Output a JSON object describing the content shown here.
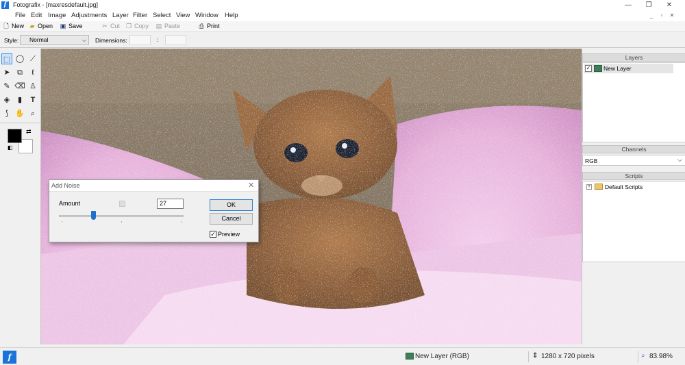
{
  "window": {
    "title": "Fotografix - [maxresdefault.jpg]",
    "app_glyph": "f",
    "controls": {
      "minimize": "—",
      "maximize": "❐",
      "close": "✕"
    },
    "doc_controls": {
      "minimize": "_",
      "restore": "▫",
      "close": "✕"
    }
  },
  "menu": [
    "File",
    "Edit",
    "Image",
    "Adjustments",
    "Layer",
    "Filter",
    "Select",
    "View",
    "Window",
    "Help"
  ],
  "toolbar": {
    "new": "New",
    "open": "Open",
    "save": "Save",
    "cut": "Cut",
    "copy": "Copy",
    "paste": "Paste",
    "print": "Print"
  },
  "options": {
    "style_label": "Style:",
    "style_value": "Normal",
    "dimensions_label": "Dimensions:",
    "dimensions_sep": ":"
  },
  "tools": [
    {
      "name": "rect-select-icon",
      "glyph": "⬚"
    },
    {
      "name": "ellipse-select-icon",
      "glyph": "◯"
    },
    {
      "name": "magic-wand-icon",
      "glyph": "⟋"
    },
    {
      "name": "move-icon",
      "glyph": "➤"
    },
    {
      "name": "crop-icon",
      "glyph": "⧉"
    },
    {
      "name": "lasso-icon",
      "glyph": "ℓ"
    },
    {
      "name": "brush-icon",
      "glyph": "✎"
    },
    {
      "name": "eraser-icon",
      "glyph": "⌫"
    },
    {
      "name": "clone-stamp-icon",
      "glyph": "♙"
    },
    {
      "name": "bucket-icon",
      "glyph": "◈"
    },
    {
      "name": "gradient-icon",
      "glyph": "▮"
    },
    {
      "name": "text-icon",
      "glyph": "T"
    },
    {
      "name": "eyedropper-icon",
      "glyph": "⟆"
    },
    {
      "name": "hand-icon",
      "glyph": "✋"
    },
    {
      "name": "zoom-icon",
      "glyph": "⌕"
    }
  ],
  "colors": {
    "foreground": "#000000",
    "background": "#ffffff",
    "accent": "#2d7fd6"
  },
  "panels": {
    "layers": {
      "title": "Layers",
      "layer_name": "New Layer",
      "visible": true
    },
    "channels": {
      "title": "Channels",
      "selected": "RGB"
    },
    "scripts": {
      "title": "Scripts",
      "folder": "Default Scripts"
    }
  },
  "dialog": {
    "title": "Add Noise",
    "amount_label": "Amount",
    "amount_value": "27",
    "slider_fraction": 0.27,
    "ok": "OK",
    "cancel": "Cancel",
    "preview_label": "Preview",
    "preview_checked": true
  },
  "status": {
    "layer": "New Layer (RGB)",
    "size": "1280 x 720 pixels",
    "zoom": "83.98%"
  }
}
